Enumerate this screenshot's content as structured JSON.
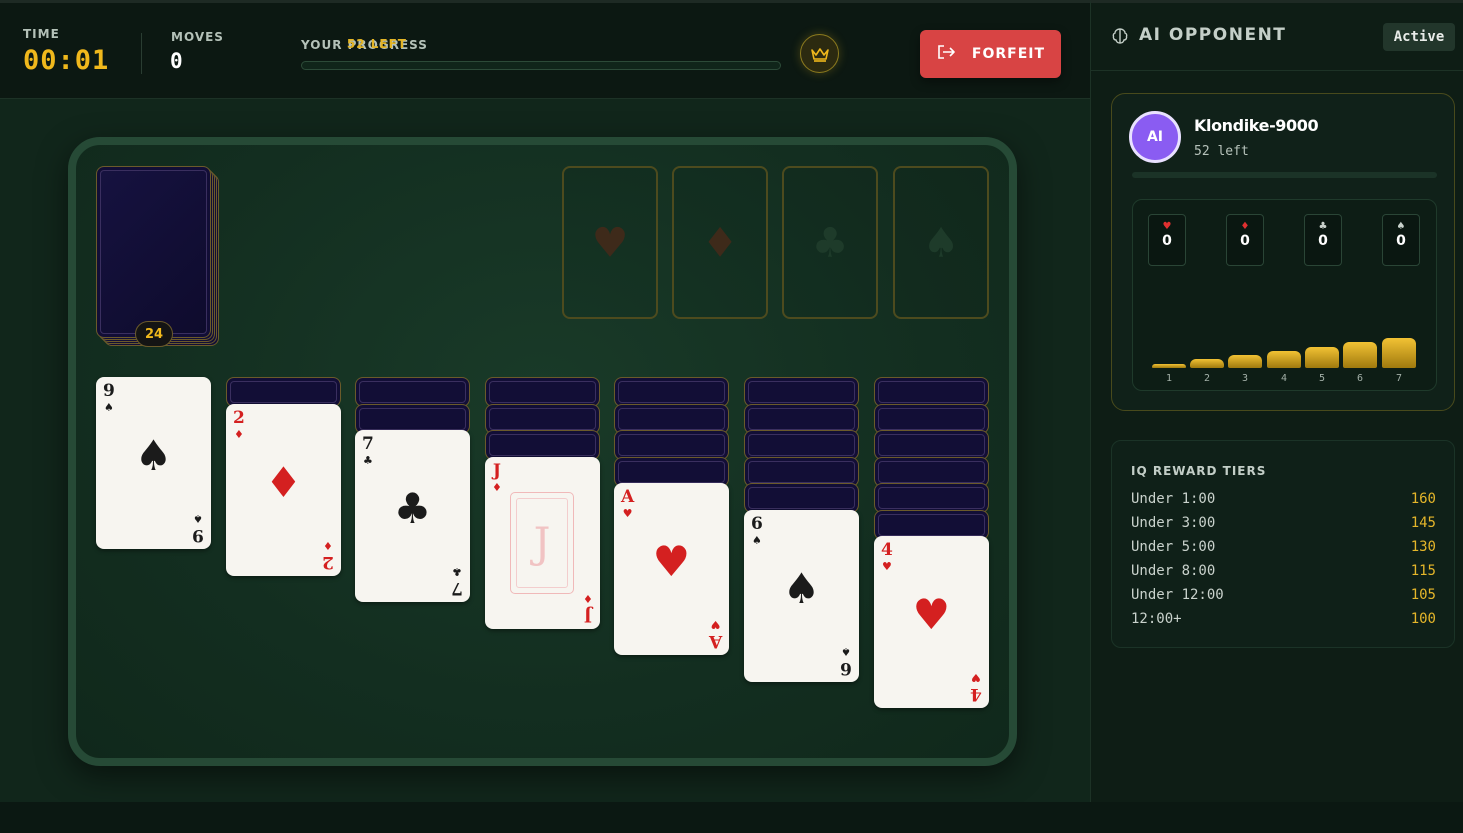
{
  "header": {
    "time_label": "TIME",
    "time_value": "00:01",
    "moves_label": "MOVES",
    "moves_value": "0",
    "progress_label": "YOUR PROGRESS",
    "progress_value": 0,
    "cards_left": "52 LEFT",
    "crown_icon": "crown-icon",
    "forfeit_label": "FORFEIT",
    "forfeit_icon": "exit-icon"
  },
  "board": {
    "stock_count": "24",
    "foundations": [
      {
        "suit": "♥",
        "color": "#3e2a1a"
      },
      {
        "suit": "♦",
        "color": "#3e2a1a"
      },
      {
        "suit": "♣",
        "color": "#1e3b2a"
      },
      {
        "suit": "♠",
        "color": "#1e3b2a"
      }
    ],
    "tableau": [
      {
        "hidden": 0,
        "rank": "9",
        "suit": "♠",
        "color": "black"
      },
      {
        "hidden": 1,
        "rank": "2",
        "suit": "♦",
        "color": "red"
      },
      {
        "hidden": 2,
        "rank": "7",
        "suit": "♣",
        "color": "black"
      },
      {
        "hidden": 3,
        "rank": "J",
        "suit": "♦",
        "color": "red",
        "face": "J"
      },
      {
        "hidden": 4,
        "rank": "A",
        "suit": "♥",
        "color": "red"
      },
      {
        "hidden": 5,
        "rank": "6",
        "suit": "♠",
        "color": "black"
      },
      {
        "hidden": 6,
        "rank": "4",
        "suit": "♥",
        "color": "red"
      }
    ]
  },
  "side": {
    "title": "AI OPPONENT",
    "status": "Active",
    "opponent": {
      "avatar": "AI",
      "name": "Klondike-9000",
      "left": "52 left",
      "progress": 0,
      "foundations": [
        {
          "suit": "♥",
          "value": "0",
          "color": "#e03030"
        },
        {
          "suit": "♦",
          "value": "0",
          "color": "#e03030"
        },
        {
          "suit": "♣",
          "value": "0",
          "color": "#c9d2cc"
        },
        {
          "suit": "♠",
          "value": "0",
          "color": "#c9d2cc"
        }
      ],
      "piles": [
        {
          "label": "1",
          "cards": 1
        },
        {
          "label": "2",
          "cards": 2
        },
        {
          "label": "3",
          "cards": 3
        },
        {
          "label": "4",
          "cards": 4
        },
        {
          "label": "5",
          "cards": 5
        },
        {
          "label": "6",
          "cards": 6
        },
        {
          "label": "7",
          "cards": 7
        }
      ]
    },
    "tiers_title": "IQ REWARD TIERS",
    "tiers": [
      {
        "label": "Under 1:00",
        "value": "160"
      },
      {
        "label": "Under 3:00",
        "value": "145"
      },
      {
        "label": "Under 5:00",
        "value": "130"
      },
      {
        "label": "Under 8:00",
        "value": "115"
      },
      {
        "label": "Under 12:00",
        "value": "105"
      },
      {
        "label": "12:00+",
        "value": "100"
      }
    ]
  }
}
